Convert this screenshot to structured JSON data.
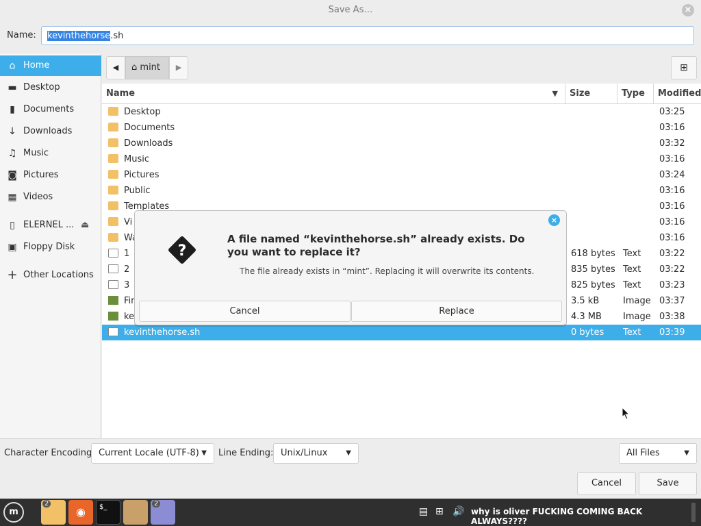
{
  "window": {
    "title": "Save As…"
  },
  "name_field": {
    "label": "Name:",
    "selected": "kevinthehorse",
    "suffix": ".sh"
  },
  "sidebar": {
    "items": [
      {
        "label": "Home",
        "icon": "home-icon"
      },
      {
        "label": "Desktop",
        "icon": "desktop-icon"
      },
      {
        "label": "Documents",
        "icon": "document-icon"
      },
      {
        "label": "Downloads",
        "icon": "download-icon"
      },
      {
        "label": "Music",
        "icon": "music-icon"
      },
      {
        "label": "Pictures",
        "icon": "camera-icon"
      },
      {
        "label": "Videos",
        "icon": "film-icon"
      },
      {
        "label": "ELERNEL ...",
        "icon": "drive-icon"
      },
      {
        "label": "Floppy Disk",
        "icon": "floppy-icon"
      },
      {
        "label": "Other Locations",
        "icon": "plus-icon"
      }
    ]
  },
  "path": {
    "current": "mint"
  },
  "columns": {
    "name": "Name",
    "size": "Size",
    "type": "Type",
    "modified": "Modified"
  },
  "files": [
    {
      "name": "Desktop",
      "size": "",
      "type": "",
      "modified": "03:25",
      "kind": "folder"
    },
    {
      "name": "Documents",
      "size": "",
      "type": "",
      "modified": "03:16",
      "kind": "folder"
    },
    {
      "name": "Downloads",
      "size": "",
      "type": "",
      "modified": "03:32",
      "kind": "folder"
    },
    {
      "name": "Music",
      "size": "",
      "type": "",
      "modified": "03:16",
      "kind": "folder"
    },
    {
      "name": "Pictures",
      "size": "",
      "type": "",
      "modified": "03:24",
      "kind": "folder"
    },
    {
      "name": "Public",
      "size": "",
      "type": "",
      "modified": "03:16",
      "kind": "folder"
    },
    {
      "name": "Templates",
      "size": "",
      "type": "",
      "modified": "03:16",
      "kind": "folder"
    },
    {
      "name": "Vi",
      "size": "",
      "type": "",
      "modified": "03:16",
      "kind": "folder"
    },
    {
      "name": "Wa",
      "size": "",
      "type": "",
      "modified": "03:16",
      "kind": "folder"
    },
    {
      "name": "1",
      "size": "618 bytes",
      "type": "Text",
      "modified": "03:22",
      "kind": "doc"
    },
    {
      "name": "2",
      "size": "835 bytes",
      "type": "Text",
      "modified": "03:22",
      "kind": "doc"
    },
    {
      "name": "3",
      "size": "825 bytes",
      "type": "Text",
      "modified": "03:23",
      "kind": "doc"
    },
    {
      "name": "Fir",
      "size": "3.5 kB",
      "type": "Image",
      "modified": "03:37",
      "kind": "img"
    },
    {
      "name": "ke",
      "size": "4.3 MB",
      "type": "Image",
      "modified": "03:38",
      "kind": "img"
    },
    {
      "name": "kevinthehorse.sh",
      "size": "0 bytes",
      "type": "Text",
      "modified": "03:39",
      "kind": "doc"
    }
  ],
  "bottom": {
    "encoding_label": "Character Encoding:",
    "encoding_value": "Current Locale (UTF-8)",
    "line_ending_label": "Line Ending:",
    "line_ending_value": "Unix/Linux",
    "filter_value": "All Files",
    "cancel": "Cancel",
    "save": "Save"
  },
  "dialog": {
    "title": "A file named “kevinthehorse.sh” already exists.  Do you want to replace it?",
    "message": "The file already exists in “mint”.  Replacing it will overwrite its contents.",
    "cancel": "Cancel",
    "replace": "Replace"
  },
  "taskbar": {
    "badge_files": "2",
    "badge_editor": "2",
    "tray_text": "why is oliver FUCKING COMING BACK ALWAYS????"
  },
  "colors": {
    "accent": "#3daee9",
    "selection": "#3584e4"
  }
}
